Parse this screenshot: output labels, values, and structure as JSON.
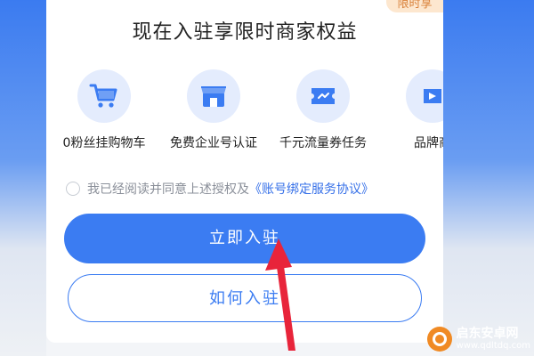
{
  "badge": "限时享",
  "title": "现在入驻享限时商家权益",
  "features": [
    {
      "icon": "shopping-cart-icon",
      "label": "0粉丝挂购物车"
    },
    {
      "icon": "storefront-icon",
      "label": "免费企业号认证"
    },
    {
      "icon": "coupon-icon",
      "label": "千元流量券任务"
    },
    {
      "icon": "brand-icon",
      "label": "品牌商"
    }
  ],
  "agreement": {
    "text": "我已经阅读并同意上述授权及",
    "link": "《账号绑定服务协议》"
  },
  "buttons": {
    "primary": "立即入驻",
    "secondary": "如何入驻"
  },
  "watermark": {
    "title": "启东安卓网",
    "url": "www.qdltdq.com"
  },
  "colors": {
    "accent": "#3b7cf2",
    "icon_bg": "#e4ecfd",
    "badge_bg": "#fde7cf",
    "arrow": "#e8243a"
  }
}
